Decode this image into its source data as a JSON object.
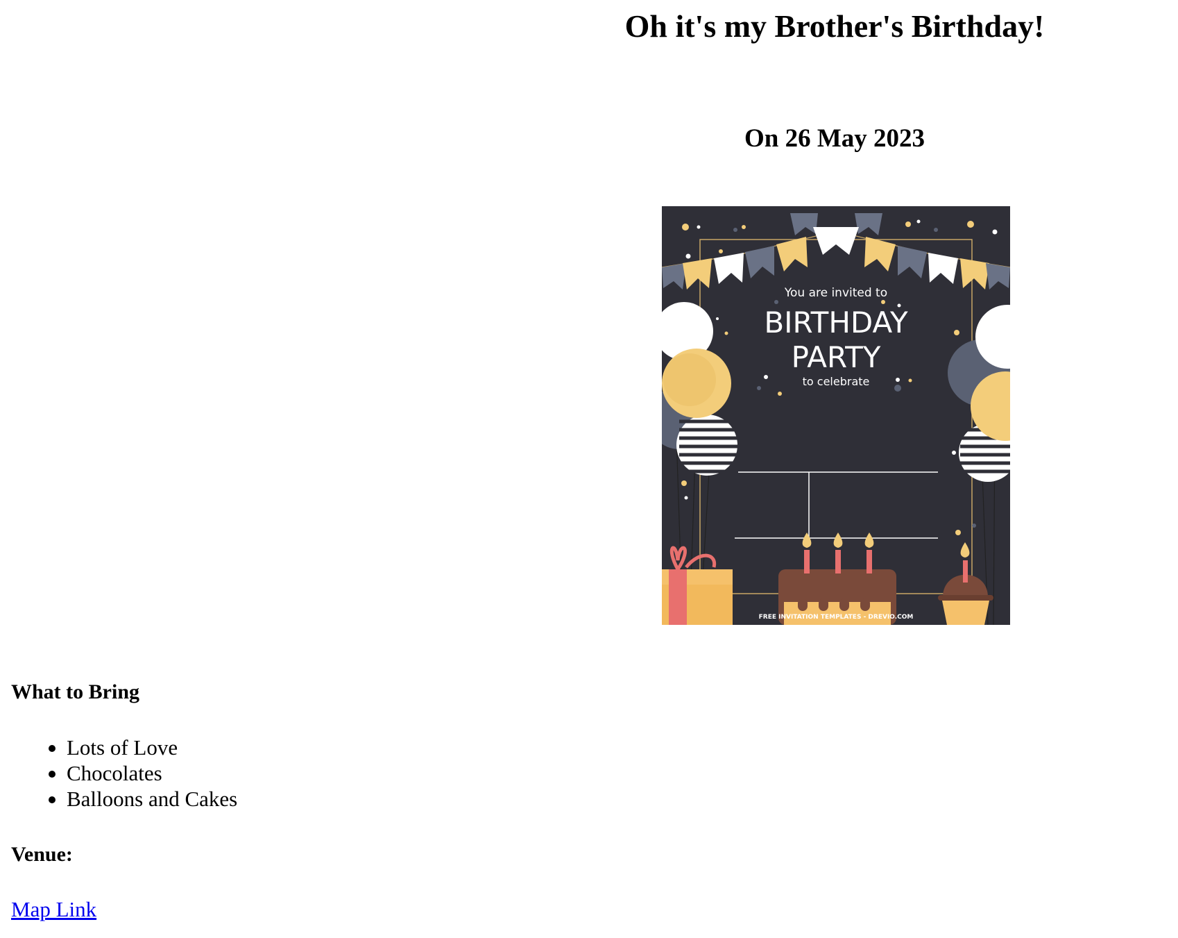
{
  "page": {
    "title": "Oh it's my Brother's Birthday!",
    "date": "On 26 May 2023"
  },
  "invitation_image": {
    "line_1": "You are invited to",
    "line_2": "BIRTHDAY",
    "line_3": "PARTY",
    "line_4": "to celebrate",
    "footer": "FREE INVITATION TEMPLATES - DREVIO.COM",
    "colors": {
      "background": "#2f2f37",
      "gold": "#f3cd7a",
      "slate": "#5a6173",
      "white": "#ffffff",
      "cake": "#7a4a3a",
      "candle": "#e8706e"
    }
  },
  "what_to_bring": {
    "heading": "What to Bring",
    "items": [
      "Lots of Love",
      "Chocolates",
      "Balloons and Cakes"
    ]
  },
  "venue": {
    "heading": "Venue:",
    "link_text": "Map Link"
  }
}
